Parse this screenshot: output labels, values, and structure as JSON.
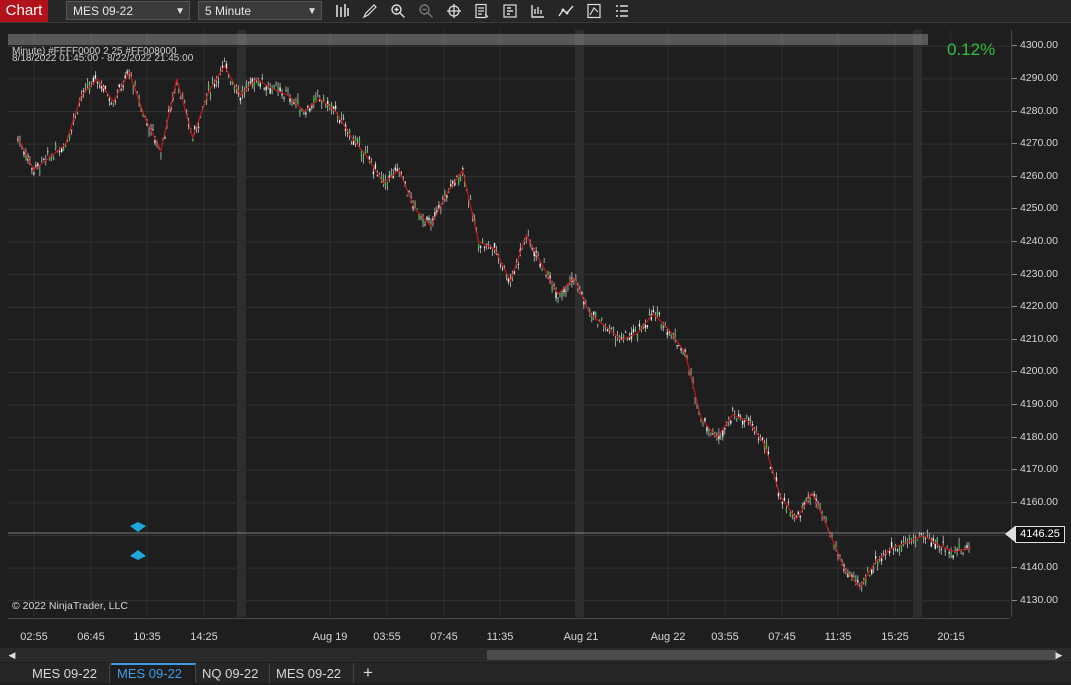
{
  "window": {
    "chart_label": "Chart"
  },
  "toolbar": {
    "instrument": "MES 09-22",
    "interval": "5 Minute",
    "icons": [
      "bars-type-icon",
      "pencil-draw-icon",
      "zoom-in-icon",
      "zoom-out-icon",
      "crosshair-icon",
      "properties-icon",
      "data-box-icon",
      "chart-trader-icon",
      "strategies-icon",
      "indicators-icon",
      "menu-list-icon"
    ]
  },
  "header": {
    "series_line": "Minute) #FFFF0000 2 25 #FF008000",
    "date_range": "8/18/2022 01:45:00 - 8/22/2022 21:45:00",
    "percent_change": "0.12%"
  },
  "copyright": "© 2022 NinjaTrader, LLC",
  "colors": {
    "up": "#3fb84a",
    "down": "#c01a1a",
    "percent": "#2fbf3f",
    "accent_tab": "#3d9be9",
    "chart_bg": "#1e1e1e"
  },
  "price_marker": {
    "value": "4146.25"
  },
  "tabs": [
    {
      "label": "MES 09-22",
      "active": false
    },
    {
      "label": "MES 09-22",
      "active": true
    },
    {
      "label": "NQ 09-22",
      "active": false
    },
    {
      "label": "MES 09-22",
      "active": false
    }
  ],
  "chart_data": {
    "type": "line",
    "instrument": "MES 09-22",
    "ylim": [
      4125,
      4305
    ],
    "yticks": [
      "4300.00",
      "4290.00",
      "4280.00",
      "4270.00",
      "4260.00",
      "4250.00",
      "4240.00",
      "4230.00",
      "4220.00",
      "4210.00",
      "4200.00",
      "4190.00",
      "4180.00",
      "4170.00",
      "4160.00",
      "4150.00",
      "4140.00",
      "4130.00"
    ],
    "xticks": [
      "02:55",
      "06:45",
      "10:35",
      "14:25",
      "Aug 19",
      "03:55",
      "07:45",
      "11:35",
      "Aug 21",
      "Aug 22",
      "03:55",
      "07:45",
      "11:35",
      "15:25",
      "20:15"
    ],
    "series": [
      {
        "x": [
          0,
          3,
          6,
          9,
          12,
          15,
          18,
          21,
          24,
          27,
          30,
          33,
          36,
          39,
          42,
          45,
          48,
          51,
          54,
          57,
          60,
          63,
          66,
          69,
          72,
          75,
          78,
          81,
          84,
          87,
          90,
          93,
          96,
          99,
          102,
          105,
          108,
          111,
          114,
          117,
          120,
          123,
          126,
          129,
          132,
          135,
          138,
          141,
          144,
          147,
          150,
          153,
          156,
          159,
          162,
          165,
          168,
          171,
          174,
          177,
          180,
          183,
          186,
          189,
          192,
          195,
          198,
          201,
          204,
          207,
          210,
          213,
          216,
          219,
          222,
          225,
          228,
          231,
          234,
          237,
          240,
          243,
          246,
          249,
          252,
          255,
          258,
          261,
          264,
          267,
          270,
          273,
          276,
          279,
          282,
          285,
          288,
          291,
          294,
          297,
          300
        ],
        "values": [
          4272,
          4262,
          4266,
          4270,
          4285,
          4290,
          4283,
          4292,
          4278,
          4268,
          4290,
          4272,
          4286,
          4294,
          4285,
          4290,
          4287,
          4285,
          4280,
          4284,
          4280,
          4272,
          4266,
          4258,
          4262,
          4250,
          4245,
          4255,
          4262,
          4240,
          4238,
          4228,
          4242,
          4233,
          4224,
          4229,
          4218,
          4214,
          4210,
          4212,
          4218,
          4213,
          4206,
          4186,
          4180,
          4187,
          4185,
          4178,
          4162,
          4155,
          4163,
          4152,
          4140,
          4134,
          4142,
          4146,
          4148,
          4150,
          4147,
          4145,
          4146.25,
          null,
          null,
          null,
          null,
          null,
          null,
          null,
          null,
          null,
          null,
          null,
          null,
          null,
          null,
          null,
          null,
          null,
          null,
          null,
          null,
          null,
          null,
          null,
          null,
          null,
          null,
          null,
          null,
          null,
          null,
          null,
          null,
          null,
          null,
          null,
          null,
          null,
          null,
          null,
          null
        ]
      }
    ],
    "session_breaks": [
      "Aug 19",
      "Aug 21",
      "Aug 22"
    ]
  }
}
